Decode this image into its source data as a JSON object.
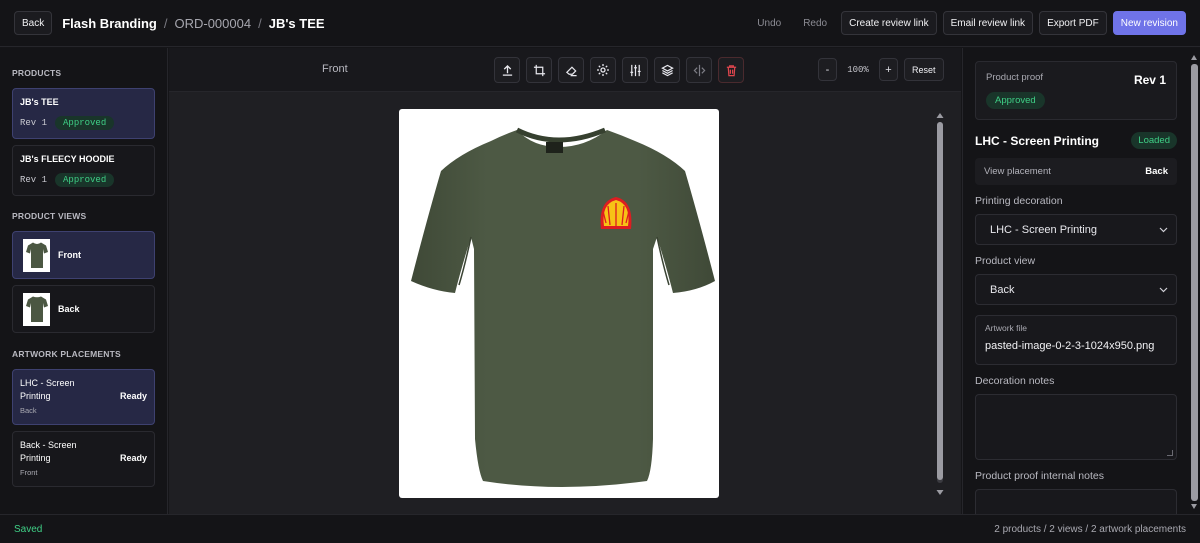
{
  "header": {
    "back_label": "Back",
    "breadcrumb": [
      "Flash Branding",
      "ORD-000004",
      "JB's TEE"
    ],
    "separator": "/",
    "actions": {
      "undo": "Undo",
      "redo": "Redo",
      "create_review_link": "Create review link",
      "email_review_link": "Email review link",
      "export_pdf": "Export PDF",
      "new_revision": "New revision"
    }
  },
  "sidebar": {
    "products_title": "PRODUCTS",
    "products": [
      {
        "name": "JB's TEE",
        "rev": "Rev 1",
        "status": "Approved"
      },
      {
        "name": "JB's FLEECY HOODIE",
        "rev": "Rev 1",
        "status": "Approved"
      }
    ],
    "views_title": "PRODUCT VIEWS",
    "views": [
      {
        "label": "Front"
      },
      {
        "label": "Back"
      }
    ],
    "placements_title": "ARTWORK PLACEMENTS",
    "placements": [
      {
        "title": "LHC - Screen Printing",
        "sub": "Back",
        "status": "Ready"
      },
      {
        "title": "Back - Screen Printing",
        "sub": "Front",
        "status": "Ready"
      }
    ]
  },
  "editor": {
    "view_name": "Front",
    "tools": [
      "upload-icon",
      "crop-icon",
      "eraser-icon",
      "gear-icon",
      "sliders-icon",
      "layers-icon",
      "flip-icon",
      "trash-icon"
    ],
    "zoom_minus": "-",
    "zoom_value": "100%",
    "zoom_plus": "+",
    "reset_label": "Reset",
    "colors": {
      "shirt": "#4b5742",
      "logo_yellow": "#f7c316",
      "logo_red": "#dd1d21"
    }
  },
  "panel": {
    "proof_label": "Product proof",
    "proof_rev": "Rev 1",
    "proof_status": "Approved",
    "placement_name": "LHC - Screen Printing",
    "placement_status": "Loaded",
    "view_placement_label": "View placement",
    "view_placement_value": "Back",
    "printing_decoration_label": "Printing decoration",
    "printing_decoration_value": "LHC - Screen Printing",
    "product_view_label": "Product view",
    "product_view_value": "Back",
    "artwork_label": "Artwork file",
    "artwork_value": "pasted-image-0-2-3-1024x950.png",
    "decoration_notes_label": "Decoration notes",
    "internal_notes_label": "Product proof internal notes"
  },
  "status": {
    "saved": "Saved",
    "summary": "2 products / 2 views / 2 artwork placements"
  },
  "theme": {
    "accent": "#6f73e8",
    "success": "#3fcf86"
  }
}
